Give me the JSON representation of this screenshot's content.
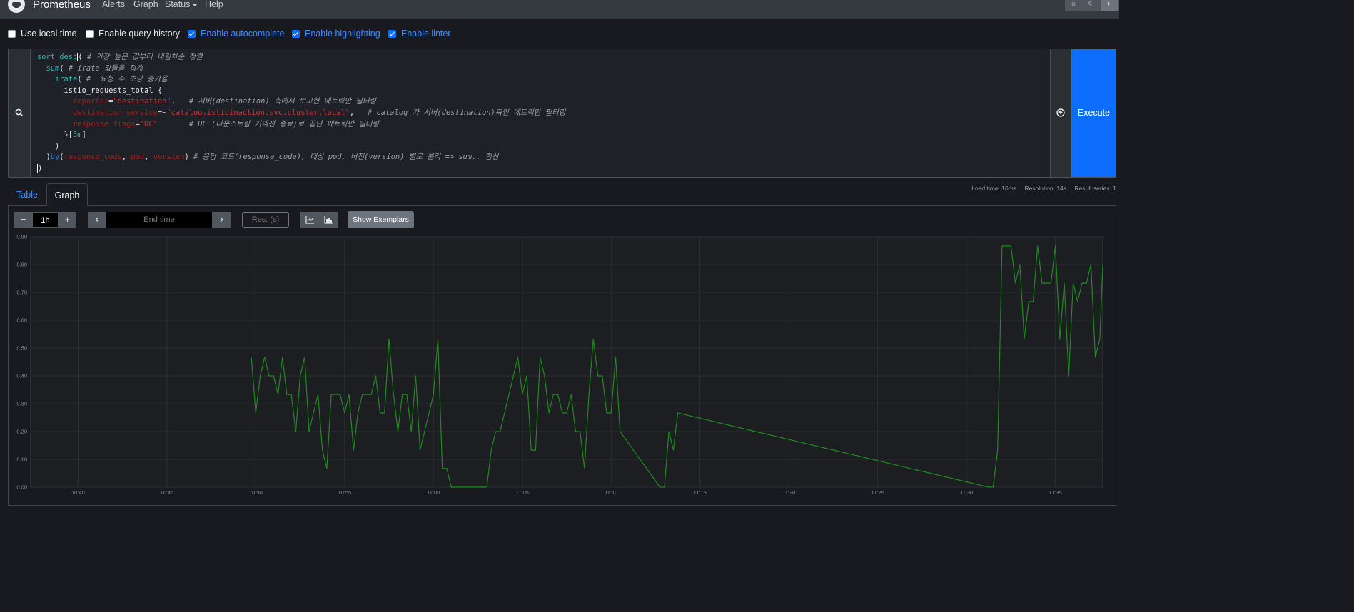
{
  "navbar": {
    "brand": "Prometheus",
    "links": [
      "Alerts",
      "Graph",
      "Status",
      "Help"
    ],
    "theme_icons": [
      "sun-icon",
      "moon-icon",
      "contrast-icon"
    ]
  },
  "options": {
    "use_local_time": {
      "label": "Use local time",
      "checked": false
    },
    "query_history": {
      "label": "Enable query history",
      "checked": false
    },
    "autocomplete": {
      "label": "Enable autocomplete",
      "checked": true
    },
    "highlighting": {
      "label": "Enable highlighting",
      "checked": true
    },
    "linter": {
      "label": "Enable linter",
      "checked": true
    }
  },
  "query": {
    "lines": [
      {
        "tokens": [
          [
            "fn",
            "sort_desc"
          ],
          [
            "cur",
            "("
          ],
          [
            "cm",
            " # 가장 높은 값부터 내림차순 정렬"
          ]
        ]
      },
      {
        "tokens": [
          [
            "op",
            "  "
          ],
          [
            "fn",
            "sum"
          ],
          [
            "op",
            "( "
          ],
          [
            "cm",
            "# irate 값들을 집계"
          ]
        ]
      },
      {
        "tokens": [
          [
            "op",
            "    "
          ],
          [
            "fn",
            "irate"
          ],
          [
            "op",
            "( "
          ],
          [
            "cm",
            "#  요청 수 초당 증가율"
          ]
        ]
      },
      {
        "tokens": [
          [
            "op",
            "      istio_requests_total {"
          ]
        ]
      },
      {
        "tokens": [
          [
            "op",
            "        "
          ],
          [
            "lb",
            "reporter"
          ],
          [
            "op",
            "="
          ],
          [
            "st",
            "\"destination\""
          ],
          [
            "op",
            ",   "
          ],
          [
            "cm",
            "# 서버(destination) 측에서 보고한 메트릭만 필터링"
          ]
        ]
      },
      {
        "tokens": [
          [
            "op",
            "        "
          ],
          [
            "lb",
            "destination_service"
          ],
          [
            "op",
            "=~"
          ],
          [
            "st",
            "\"catalog.istioinaction.svc.cluster.local\""
          ],
          [
            "op",
            ",   "
          ],
          [
            "cm",
            "# catalog 가 서버(destination)측인 메트릭만 필터링"
          ]
        ]
      },
      {
        "tokens": [
          [
            "op",
            "        "
          ],
          [
            "lb",
            "response_flags"
          ],
          [
            "op",
            "="
          ],
          [
            "st",
            "\"DC\""
          ],
          [
            "op",
            "       "
          ],
          [
            "cm",
            "# DC (다운스트림 커넥션 종료)로 끝난 메트릭만 필터링"
          ]
        ]
      },
      {
        "tokens": [
          [
            "op",
            "      }["
          ],
          [
            "nm",
            "5m"
          ],
          [
            "op",
            "]"
          ]
        ]
      },
      {
        "tokens": [
          [
            "op",
            "    )"
          ]
        ]
      },
      {
        "tokens": [
          [
            "op",
            "  )"
          ],
          [
            "ag",
            "by"
          ],
          [
            "op",
            "("
          ],
          [
            "lb",
            "response_code"
          ],
          [
            "op",
            ", "
          ],
          [
            "lb",
            "pod"
          ],
          [
            "op",
            ", "
          ],
          [
            "lb",
            "version"
          ],
          [
            "op",
            ") "
          ],
          [
            "cm",
            "# 응답 코드(response_code), 대상 pod, 버전(version) 별로 분리 => sum.. 합산"
          ]
        ]
      },
      {
        "tokens": [
          [
            "cur",
            ")"
          ]
        ]
      }
    ],
    "execute_label": "Execute"
  },
  "tabs": {
    "table": "Table",
    "graph": "Graph"
  },
  "stats": {
    "load_time": "Load time: 16ms",
    "resolution": "Resolution: 14s",
    "result_series": "Result series: 1"
  },
  "controls": {
    "minus": "−",
    "range": "1h",
    "plus": "+",
    "prev": "‹",
    "end_placeholder": "End time",
    "next": "›",
    "res_placeholder": "Res. (s)",
    "exemplars": "Show Exemplars"
  },
  "chart_data": {
    "type": "line",
    "title": "",
    "xlabel": "",
    "ylabel": "",
    "ylim": [
      0,
      0.9
    ],
    "yticks": [
      "0.00",
      "0.10",
      "0.20",
      "0.30",
      "0.40",
      "0.50",
      "0.60",
      "0.70",
      "0.80",
      "0.90"
    ],
    "xlim": [
      "10:37:20",
      "11:37:40"
    ],
    "xticks": [
      "10:40",
      "10:45",
      "10:50",
      "10:55",
      "11:00",
      "11:05",
      "11:10",
      "11:15",
      "11:20",
      "11:25",
      "11:30",
      "11:35"
    ],
    "grid": true,
    "color": "#1f8a1f",
    "series": [
      {
        "x": [
          "10:49:45",
          "10:50:00",
          "10:50:15",
          "10:50:30",
          "10:50:45",
          "10:51:00",
          "10:51:15",
          "10:51:30",
          "10:51:45",
          "10:52:00",
          "10:52:15",
          "10:52:30",
          "10:52:45",
          "10:53:00",
          "10:53:15",
          "10:53:30",
          "10:53:45",
          "10:54:00",
          "10:54:15",
          "10:54:30",
          "10:54:45",
          "10:55:00",
          "10:55:15",
          "10:55:30",
          "10:55:45",
          "10:56:00",
          "10:56:15",
          "10:56:30",
          "10:56:45",
          "10:57:00",
          "10:57:15",
          "10:57:30",
          "10:57:45",
          "10:58:00",
          "10:58:15",
          "10:58:30",
          "10:58:45",
          "10:59:00",
          "10:59:15",
          "10:59:30",
          "10:59:45",
          "11:00:00",
          "11:00:15",
          "11:00:30",
          "11:00:45",
          "11:01:00",
          "11:01:15",
          "11:03:00",
          "11:03:15",
          "11:03:30",
          "11:03:45",
          "11:04:00",
          "11:04:15",
          "11:04:30",
          "11:04:45",
          "11:05:00",
          "11:05:15",
          "11:05:30",
          "11:05:45",
          "11:06:00",
          "11:06:15",
          "11:06:30",
          "11:06:45",
          "11:07:00",
          "11:07:15",
          "11:07:30",
          "11:07:45",
          "11:08:00",
          "11:08:15",
          "11:08:30",
          "11:08:45",
          "11:09:00",
          "11:09:15",
          "11:09:30",
          "11:09:45",
          "11:10:00",
          "11:10:15",
          "11:10:30",
          "11:12:45",
          "11:13:00",
          "11:13:15",
          "11:13:30",
          "11:13:45",
          "11:31:15",
          "11:31:30",
          "11:31:45",
          "11:32:00",
          "11:32:15",
          "11:32:30",
          "11:32:45",
          "11:33:00",
          "11:33:15",
          "11:33:30",
          "11:33:45",
          "11:34:00",
          "11:34:15",
          "11:34:30",
          "11:34:45",
          "11:35:00",
          "11:35:15",
          "11:35:30",
          "11:35:45",
          "11:36:00",
          "11:36:15",
          "11:36:30",
          "11:36:45",
          "11:37:00",
          "11:37:15",
          "11:37:30",
          "11:37:40"
        ],
        "y": [
          0.467,
          0.267,
          0.4,
          0.467,
          0.4,
          0.4,
          0.333,
          0.467,
          0.333,
          0.333,
          0.2,
          0.4,
          0.467,
          0.2,
          0.267,
          0.333,
          0.133,
          0.067,
          0.333,
          0.333,
          0.333,
          0.267,
          0.333,
          0.133,
          0.267,
          0.333,
          0.333,
          0.333,
          0.4,
          0.267,
          0.267,
          0.533,
          0.333,
          0.2,
          0.333,
          0.333,
          0.2,
          0.4,
          0.133,
          0.2,
          0.267,
          0.333,
          0.533,
          0.067,
          0.067,
          0.0,
          0.0,
          0.0,
          0.133,
          0.2,
          0.2,
          0.267,
          0.333,
          0.4,
          0.467,
          0.333,
          0.4,
          0.133,
          0.133,
          0.467,
          0.4,
          0.267,
          0.333,
          0.333,
          0.267,
          0.267,
          0.333,
          0.2,
          0.2,
          0.067,
          0.333,
          0.533,
          0.4,
          0.4,
          0.267,
          0.267,
          0.467,
          0.2,
          0.0,
          0.0,
          0.2,
          0.133,
          0.267,
          0.0,
          0.0,
          0.133,
          0.867,
          0.867,
          0.867,
          0.733,
          0.8,
          0.533,
          0.667,
          0.667,
          0.867,
          0.733,
          0.733,
          0.733,
          0.867,
          0.533,
          0.733,
          0.4,
          0.733,
          0.667,
          0.733,
          0.733,
          0.8,
          0.467,
          0.533,
          0.8
        ]
      }
    ]
  }
}
